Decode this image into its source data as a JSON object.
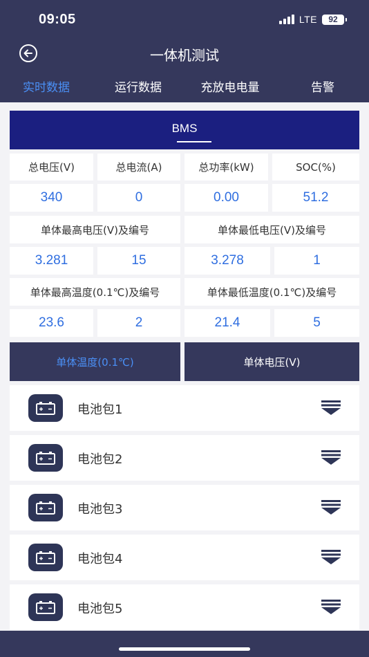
{
  "status": {
    "time": "09:05",
    "network": "LTE",
    "battery": "92"
  },
  "header": {
    "title": "一体机测试"
  },
  "tabs": [
    {
      "label": "实时数据",
      "active": true
    },
    {
      "label": "运行数据",
      "active": false
    },
    {
      "label": "充放电电量",
      "active": false
    },
    {
      "label": "告警",
      "active": false
    }
  ],
  "bms": {
    "label": "BMS",
    "labels_row1": [
      "总电压(V)",
      "总电流(A)",
      "总功率(kW)",
      "SOC(%)"
    ],
    "values_row1": [
      "340",
      "0",
      "0.00",
      "51.2"
    ],
    "max_voltage_label": "单体最高电压(V)及编号",
    "min_voltage_label": "单体最低电压(V)及编号",
    "voltage_values": [
      "3.281",
      "15",
      "3.278",
      "1"
    ],
    "max_temp_label": "单体最高温度(0.1℃)及编号",
    "min_temp_label": "单体最低温度(0.1℃)及编号",
    "temp_values": [
      "23.6",
      "2",
      "21.4",
      "5"
    ]
  },
  "sub_tabs": [
    {
      "label": "单体温度(0.1℃)",
      "active": true
    },
    {
      "label": "单体电压(V)",
      "active": false
    }
  ],
  "packs": [
    {
      "label": "电池包1",
      "icon": "battery-icon"
    },
    {
      "label": "电池包2",
      "icon": "battery-icon"
    },
    {
      "label": "电池包3",
      "icon": "battery-icon"
    },
    {
      "label": "电池包4",
      "icon": "battery-icon"
    },
    {
      "label": "电池包5",
      "icon": "battery-icon"
    }
  ],
  "colors": {
    "header": "#35385c",
    "bms_header": "#1b1f80",
    "accent": "#4a8ff5",
    "value": "#2f6ee0"
  }
}
